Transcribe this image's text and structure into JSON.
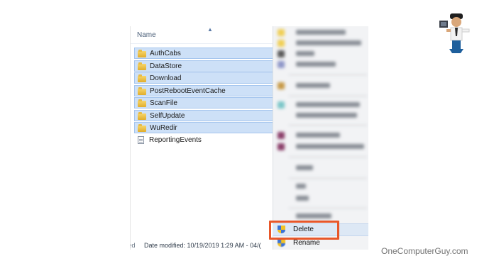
{
  "explorer": {
    "column_header": "Name",
    "items": [
      {
        "label": "AuthCabs",
        "type": "folder",
        "selected": true
      },
      {
        "label": "DataStore",
        "type": "folder",
        "selected": true
      },
      {
        "label": "Download",
        "type": "folder",
        "selected": true
      },
      {
        "label": "PostRebootEventCache",
        "type": "folder",
        "selected": true
      },
      {
        "label": "ScanFile",
        "type": "folder",
        "selected": true
      },
      {
        "label": "SelfUpdate",
        "type": "folder",
        "selected": true
      },
      {
        "label": "WuRedir",
        "type": "folder",
        "selected": true
      },
      {
        "label": "ReportingEvents",
        "type": "file",
        "selected": false
      }
    ]
  },
  "status_bar": {
    "prefix": "ted",
    "text": "Date modified: 10/19/2019 1:29 AM - 04/("
  },
  "context_menu": {
    "delete_label": "Delete",
    "rename_label": "Rename",
    "highlight_color": "#e8572a"
  },
  "watermark": {
    "text": "OneComputerGuy.com"
  }
}
